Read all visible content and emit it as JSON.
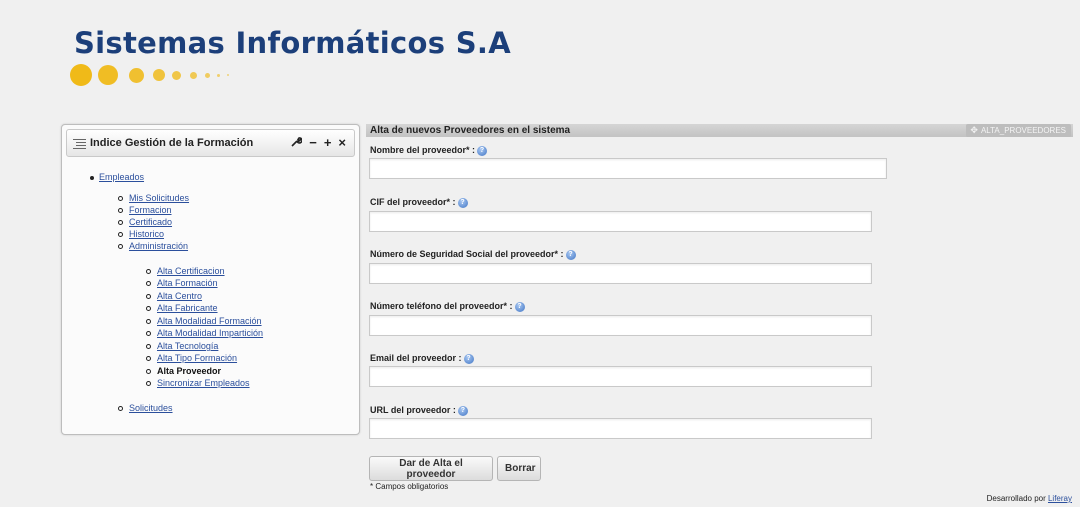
{
  "header": {
    "company_name": "Sistemas Informáticos S.A"
  },
  "sidebar": {
    "title": "Indice Gestión de la Formación",
    "tools": {
      "configure_icon": "wrench-icon",
      "minimize": "−",
      "maximize": "+",
      "close": "×"
    },
    "tree": {
      "root_label": "Empleados",
      "children": [
        "Mis Solicitudes",
        "Formacion",
        "Certificado",
        "Historico",
        "Administración"
      ],
      "admin_children": [
        "Alta Certificacion",
        "Alta Formación",
        "Alta Centro",
        "Alta Fabricante",
        "Alta Modalidad Formación",
        "Alta Modalidad Impartición",
        "Alta Tecnología",
        "Alta Tipo Formación",
        "Alta Proveedor",
        "Sincronizar Empleados"
      ],
      "current_item": "Alta Proveedor",
      "last_child": "Solicitudes"
    }
  },
  "main": {
    "title": "Alta de nuevos Proveedores en el sistema",
    "portlet_id": "ALTA_PROVEEDORES",
    "fields": [
      {
        "label": "Nombre del proveedor* :",
        "value": ""
      },
      {
        "label": "CIF del proveedor* :",
        "value": ""
      },
      {
        "label": "Número de Seguridad Social del proveedor* :",
        "value": ""
      },
      {
        "label": "Número teléfono del proveedor* :",
        "value": ""
      },
      {
        "label": "Email del proveedor :",
        "value": ""
      },
      {
        "label": "URL del proveedor :",
        "value": ""
      }
    ],
    "help_icon": "?",
    "submit_label": "Dar de Alta el proveedor",
    "reset_label": "Borrar",
    "required_note": "* Campos obligatorios"
  },
  "footer": {
    "text": "Desarrollado por",
    "link": "Liferay"
  },
  "colors": {
    "brand_title": "#1c3f7a",
    "brand_dots": "#f0b400",
    "link": "#2b4f9c",
    "header_bar": "#c8c8c8"
  }
}
